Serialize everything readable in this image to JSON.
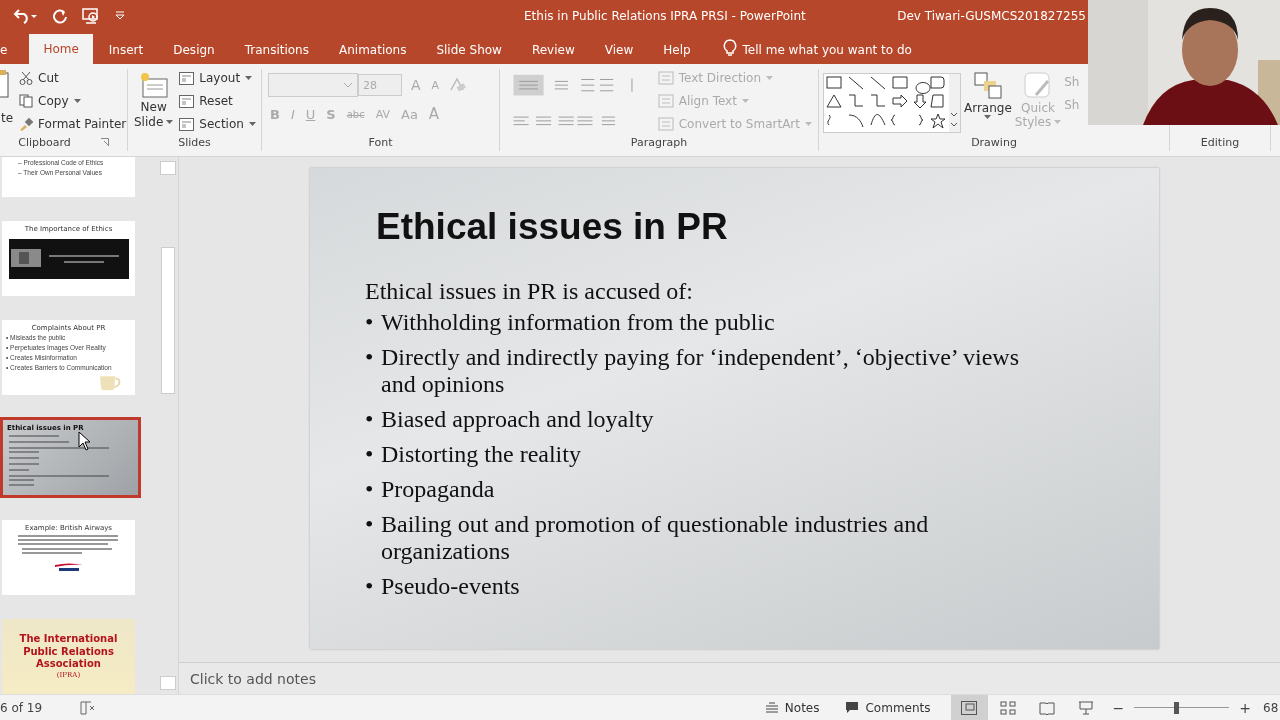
{
  "title_bar": {
    "title": "Ethis in Public Relations IPRA PRSI  -  PowerPoint",
    "user": "Dev Tiwari-GUSMCS201827255"
  },
  "tabs": [
    {
      "label": "e",
      "selected": false
    },
    {
      "label": "Home",
      "selected": true
    },
    {
      "label": "Insert",
      "selected": false
    },
    {
      "label": "Design",
      "selected": false
    },
    {
      "label": "Transitions",
      "selected": false
    },
    {
      "label": "Animations",
      "selected": false
    },
    {
      "label": "Slide Show",
      "selected": false
    },
    {
      "label": "Review",
      "selected": false
    },
    {
      "label": "View",
      "selected": false
    },
    {
      "label": "Help",
      "selected": false
    }
  ],
  "tell_me": "Tell me what you want to do",
  "ribbon": {
    "clipboard": {
      "label": "Clipboard",
      "paste": "te",
      "commands": [
        "Cut",
        "Copy",
        "Format Painter"
      ]
    },
    "slides": {
      "label": "Slides",
      "new_slide": "New",
      "new_slide_2": "Slide",
      "commands": [
        "Layout",
        "Reset",
        "Section"
      ]
    },
    "font": {
      "label": "Font",
      "size": "28",
      "size_buttons": [
        "A",
        "A"
      ],
      "format_buttons": [
        "B",
        "I",
        "U",
        "S",
        "abc",
        "AV",
        "Aa",
        "A"
      ],
      "disabled": true
    },
    "paragraph": {
      "label": "Paragraph",
      "commands": [
        {
          "label": "Text Direction",
          "disabled": true
        },
        {
          "label": "Align Text",
          "disabled": true
        },
        {
          "label": "Convert to SmartArt",
          "disabled": true
        }
      ]
    },
    "drawing": {
      "label": "Drawing",
      "arrange": "Arrange",
      "quick_styles": "Quick",
      "quick_styles_2": "Styles",
      "shape_commands": [
        "Sh",
        "Sh"
      ]
    },
    "editing": {
      "label": "Editing"
    }
  },
  "thumbnails": [
    {
      "kind": "bullets-top",
      "lines": [
        "– Professional Code of Ethics",
        "– Their Own Personal Values"
      ],
      "selected": false
    },
    {
      "kind": "quote",
      "title": "The Importance of Ethics",
      "selected": false
    },
    {
      "kind": "cup",
      "title": "Complaints About PR",
      "lines": [
        "• Misleads the public",
        "• Perpetuates Images Over Reality",
        "• Creates Misinformation",
        "• Creates Barriers to Communication"
      ],
      "selected": false
    },
    {
      "kind": "current",
      "title": "Ethical issues in PR",
      "selected": true
    },
    {
      "kind": "logo",
      "title": "Example: British Airways",
      "selected": false
    },
    {
      "kind": "banner",
      "title": "The International Public Relations Association",
      "lines": [
        "(IPRA)"
      ],
      "selected": false
    }
  ],
  "slide": {
    "title": "Ethical issues in PR",
    "intro": "Ethical issues in PR is accused of:",
    "marker": "•",
    "bullets": [
      "Withholding information from the public",
      "Directly and indirectly paying for ‘independent’, ‘objective’ views and opinions",
      "Biased approach and loyalty",
      "Distorting the reality",
      "Propaganda",
      "Bailing out and promotion of questionable industries and organizations",
      "Pseudo-events"
    ]
  },
  "notes_placeholder": "Click to add notes",
  "status_bar": {
    "slide_count": "6 of 19",
    "notes": "Notes",
    "comments": "Comments",
    "views": [
      {
        "kind": "normal",
        "selected": true
      },
      {
        "kind": "sorter",
        "selected": false
      },
      {
        "kind": "reading",
        "selected": false
      },
      {
        "kind": "show",
        "selected": false
      }
    ],
    "zoom": {
      "level": 0.42
    },
    "zoom_out": "−",
    "zoom_in": "+",
    "zoom_text": "68"
  }
}
